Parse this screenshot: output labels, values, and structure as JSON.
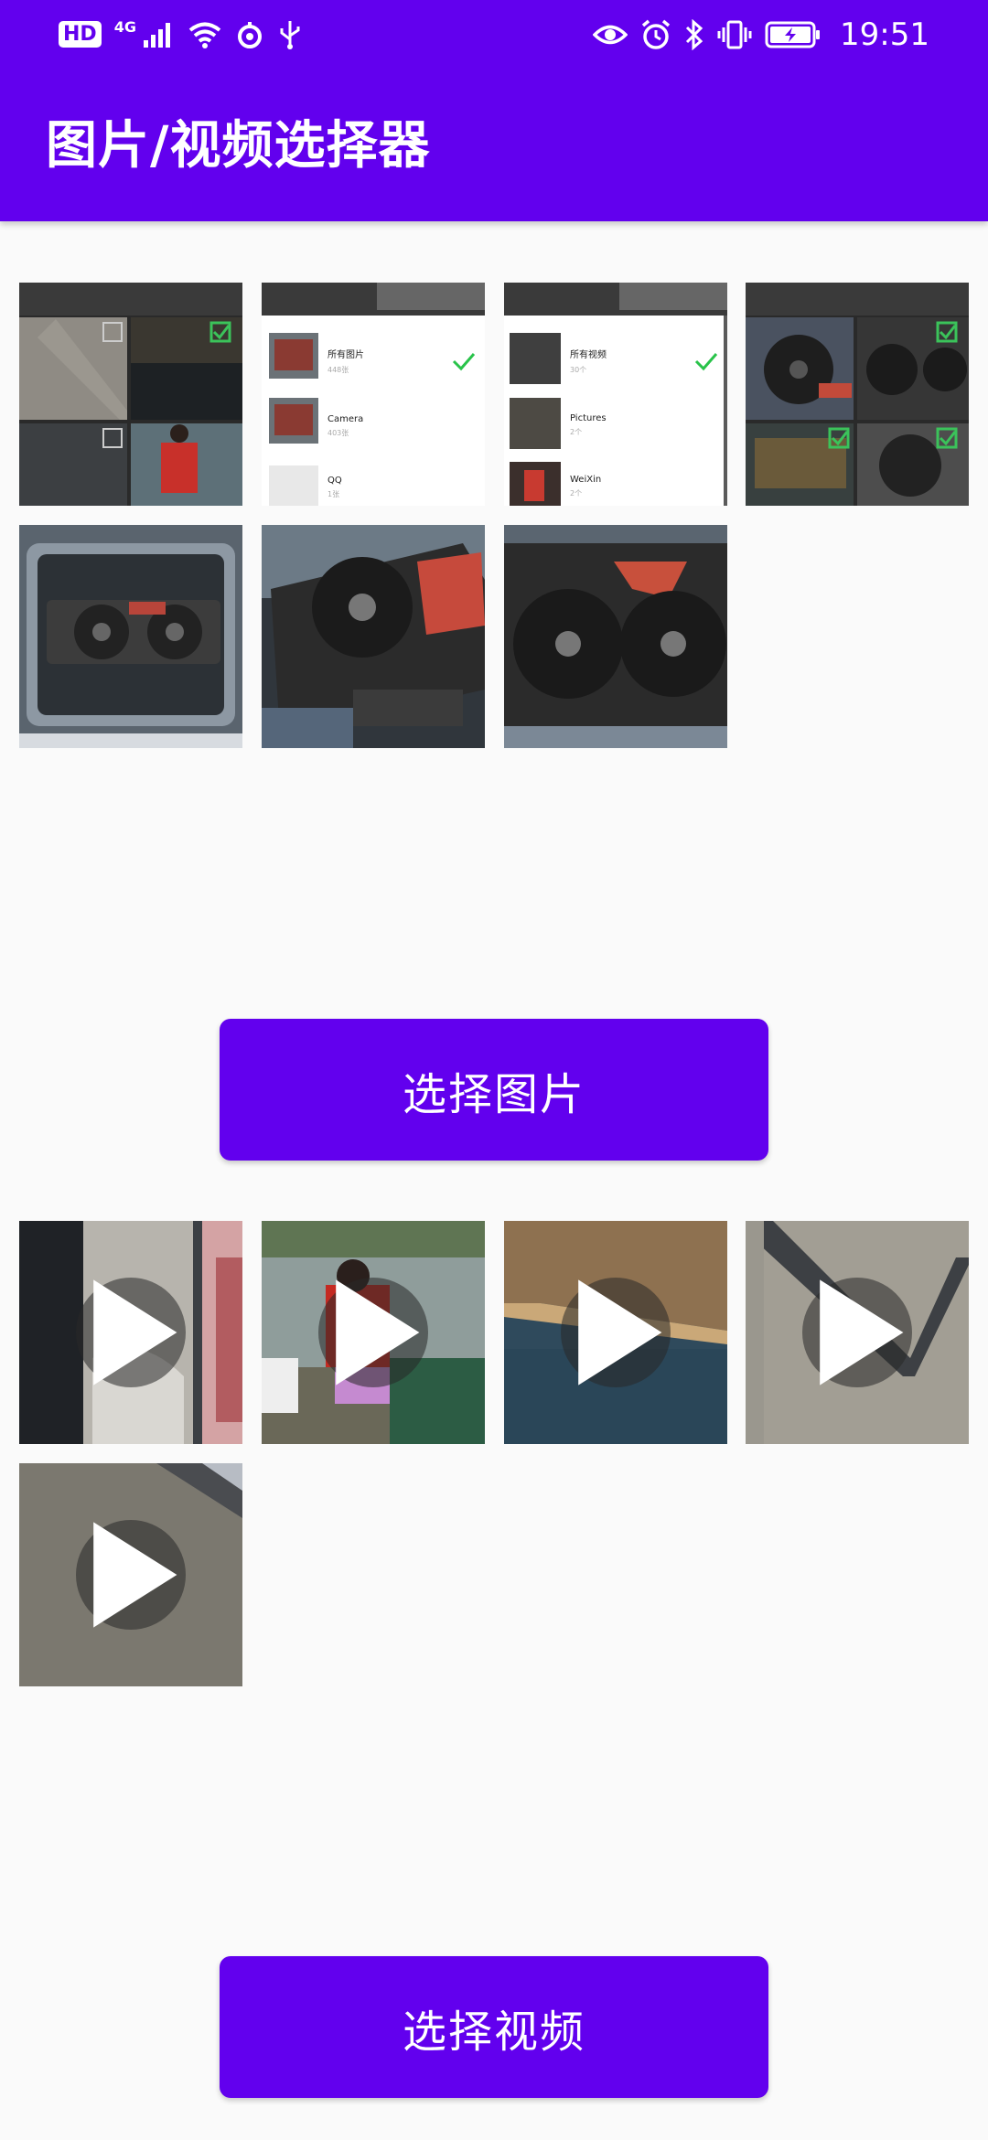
{
  "status_bar": {
    "hd_label": "HD",
    "signal_label": "4G",
    "time": "19:51"
  },
  "app_bar": {
    "title": "图片/视频选择器"
  },
  "image_thumbnails": {
    "shot1": {
      "left_tabs": "",
      "check": true
    },
    "shot2": {
      "rows": [
        {
          "name": "所有图片",
          "count": "448张"
        },
        {
          "name": "Camera",
          "count": "403张"
        },
        {
          "name": "QQ",
          "count": "1张"
        }
      ]
    },
    "shot3": {
      "rows": [
        {
          "name": "所有视频",
          "count": "30个"
        },
        {
          "name": "Pictures",
          "count": "2个"
        },
        {
          "name": "WeiXin",
          "count": "2个"
        }
      ]
    }
  },
  "buttons": {
    "select_image": "选择图片",
    "select_video": "选择视频"
  },
  "colors": {
    "primary": "#6200ee",
    "background": "#fafafa",
    "check_green": "#29c34a"
  },
  "icons": {
    "play": "play-icon",
    "check": "check-icon"
  }
}
